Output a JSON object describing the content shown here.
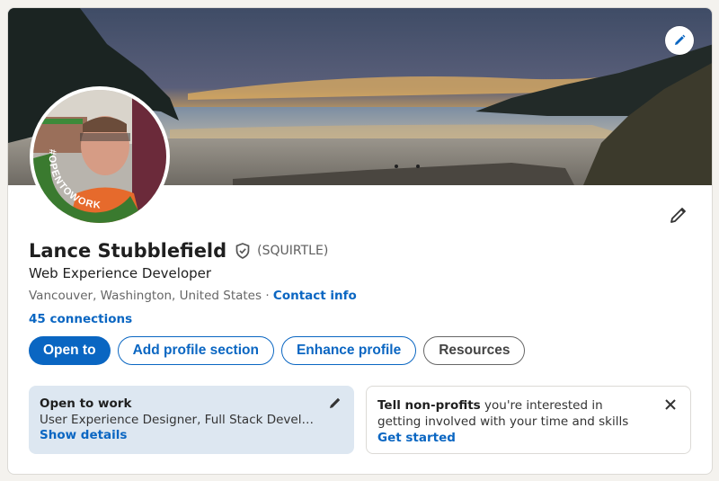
{
  "profile": {
    "name": "Lance Stubblefield",
    "pronouns": "(SQUIRTLE)",
    "headline": "Web Experience Developer",
    "location": "Vancouver, Washington, United States",
    "separator": "·",
    "contact_label": "Contact info",
    "connections": "45 connections",
    "frame_text": "#OPENTOWORK"
  },
  "actions": {
    "open_to": "Open to",
    "add_section": "Add profile section",
    "enhance": "Enhance profile",
    "resources": "Resources"
  },
  "open_to_work": {
    "title": "Open to work",
    "roles": "User Experience Designer, Full Stack Developer,...",
    "link": "Show details"
  },
  "nonprofit": {
    "bold": "Tell non-profits",
    "text": " you're interested in getting involved with your time and skills",
    "link": "Get started"
  },
  "colors": {
    "primary": "#0a66c2",
    "open_to_work_frame": "#3a7a2f",
    "open_to_work_bg": "#dde7f1"
  },
  "icons": [
    "pencil-icon",
    "verified-shield-icon",
    "close-icon"
  ]
}
